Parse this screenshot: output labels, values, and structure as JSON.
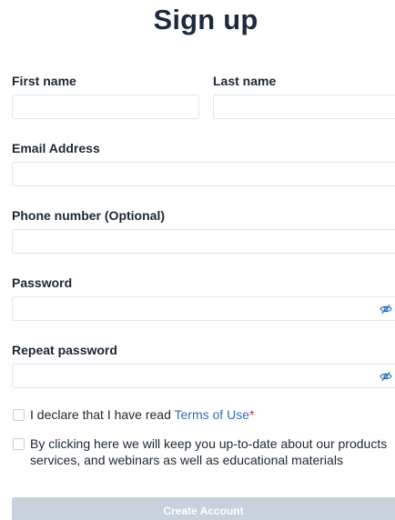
{
  "form": {
    "title": "Sign up",
    "first_name": {
      "label": "First name",
      "value": ""
    },
    "last_name": {
      "label": "Last name",
      "value": ""
    },
    "email": {
      "label": "Email Address",
      "value": ""
    },
    "phone": {
      "label": "Phone number (Optional)",
      "value": ""
    },
    "password": {
      "label": "Password",
      "value": "",
      "icon": "eye-slash-icon"
    },
    "repeat_password": {
      "label": "Repeat password",
      "value": "",
      "icon": "eye-slash-icon"
    },
    "terms": {
      "text": "I declare that I have read ",
      "link": "Terms of Use",
      "required_mark": "*",
      "checked": false
    },
    "marketing": {
      "line1": "By clicking here we will keep you up-to-date about our products",
      "line2": "services, and webinars as well as educational materials",
      "checked": false
    },
    "submit_label": "Create Account"
  },
  "colors": {
    "text": "#1c2733",
    "link": "#2f6fb5",
    "required": "#d12a2a",
    "button_disabled": "#c8d1dc",
    "input_border": "#dfe4ea"
  }
}
